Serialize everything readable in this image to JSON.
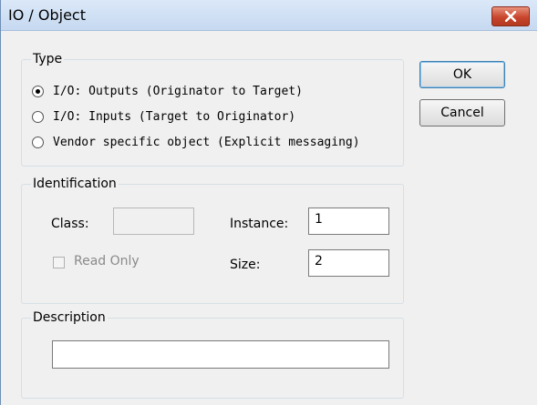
{
  "window": {
    "title": "IO / Object"
  },
  "type_group": {
    "legend": "Type",
    "options": [
      {
        "label": "I/O: Outputs (Originator to Target)",
        "checked": true
      },
      {
        "label": "I/O: Inputs (Target to Originator)",
        "checked": false
      },
      {
        "label": "Vendor specific object (Explicit messaging)",
        "checked": false
      }
    ]
  },
  "buttons": {
    "ok": "OK",
    "cancel": "Cancel"
  },
  "identification": {
    "legend": "Identification",
    "class_label": "Class:",
    "class_value": "",
    "instance_label": "Instance:",
    "instance_value": "1",
    "read_only_label": "Read Only",
    "size_label": "Size:",
    "size_value": "2"
  },
  "description": {
    "legend": "Description",
    "value": ""
  },
  "colors": {
    "title_bar": "#c6d9f1",
    "close_button": "#c8452c",
    "dialog_bg": "#f0f0f0"
  }
}
